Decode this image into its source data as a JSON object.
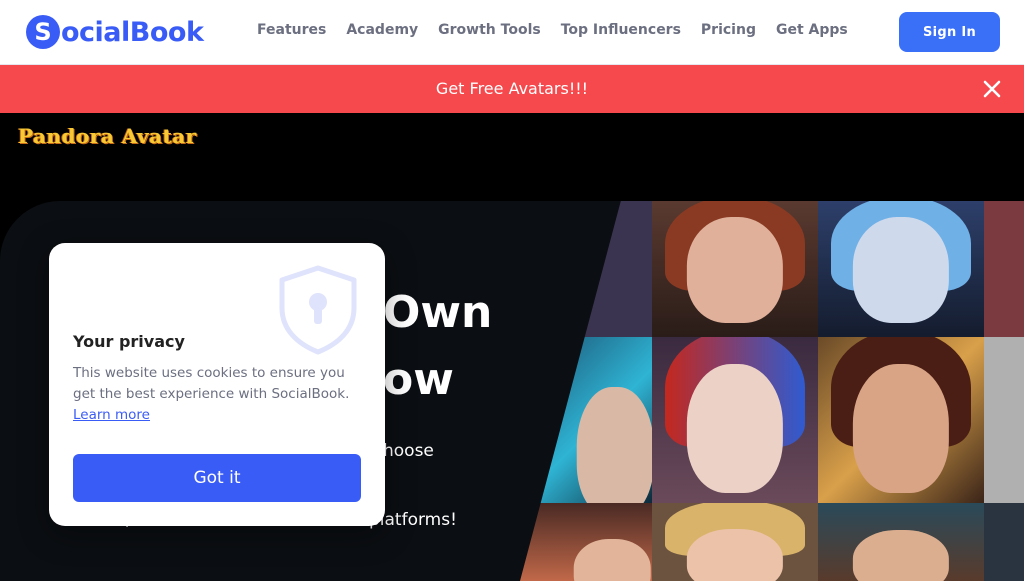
{
  "header": {
    "logo_initial": "S",
    "logo_text": "ocialBook",
    "menu": [
      "Features",
      "Academy",
      "Growth Tools",
      "Top Influencers",
      "Pricing",
      "Get Apps"
    ],
    "signin_label": "Sign In"
  },
  "banner": {
    "text": "Get Free Avatars!!!",
    "close_icon": "close-icon"
  },
  "brand": {
    "text": "Pandora Avatar"
  },
  "hero": {
    "heading_line1_end": "Own",
    "heading_line2_end": "ow",
    "para_line1_end": "hoose",
    "para_line3_end": "platforms!"
  },
  "cookie": {
    "title": "Your privacy",
    "text": "This website uses cookies to ensure you get the best experience with SocialBook.",
    "link": "Learn more",
    "button": "Got it",
    "icon": "shield-lock-icon"
  },
  "colors": {
    "brand_blue": "#3a5cf6",
    "banner_red": "#f5494d",
    "hero_bg": "#0b0e12"
  }
}
